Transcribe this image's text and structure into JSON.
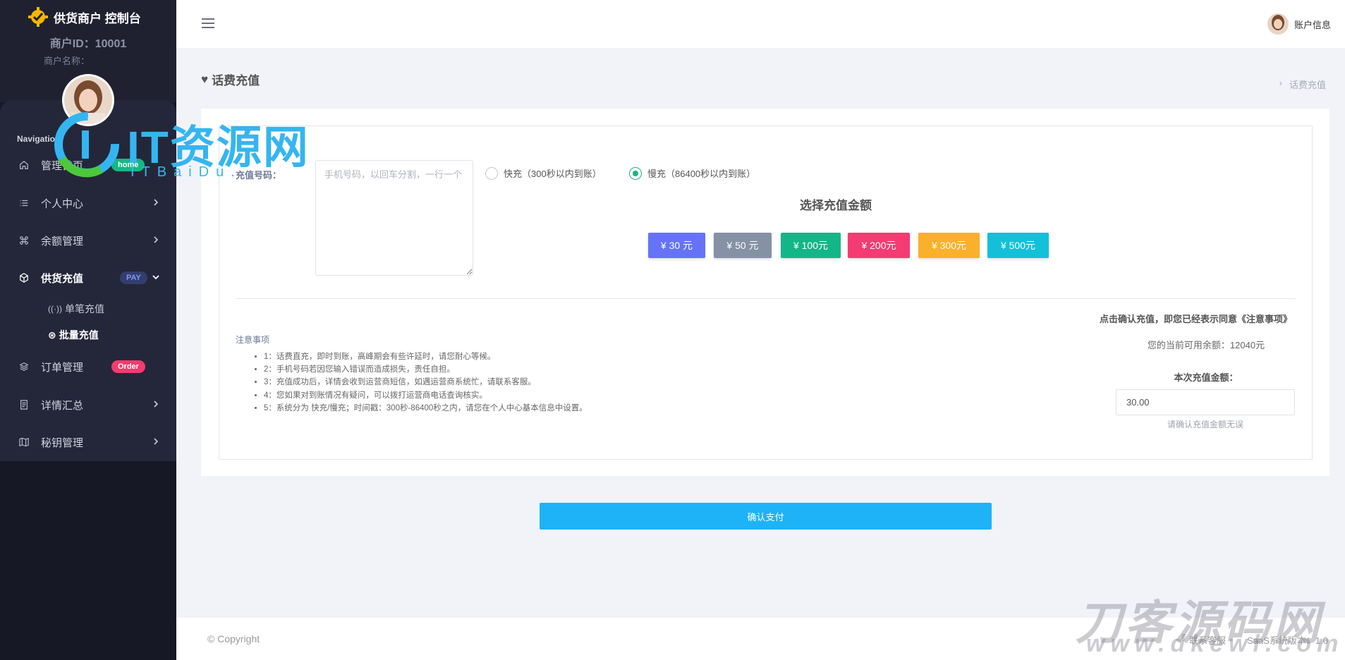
{
  "sidebar": {
    "brand": "供货商户 控制台",
    "merchant_id": "商户ID：10001",
    "merchant_name": "商户名称：",
    "nav_heading": "Navigation",
    "items": [
      {
        "label": "管理首页",
        "badge": "home"
      },
      {
        "label": "个人中心"
      },
      {
        "label": "余额管理"
      },
      {
        "label": "供货充值",
        "badge": "PAY"
      },
      {
        "label": "订单管理",
        "badge": "Order"
      },
      {
        "label": "详情汇总"
      },
      {
        "label": "秘钥管理"
      }
    ],
    "sub_items": [
      {
        "label": "单笔充值"
      },
      {
        "label": "批量充值"
      }
    ]
  },
  "topbar": {
    "account_label": "账户信息"
  },
  "page": {
    "title": "话费充值",
    "breadcrumb": "话费充值"
  },
  "form": {
    "phone_label": "充值号码：",
    "phone_placeholder": "手机号码，以回车分割，一行一个",
    "radio_fast": "快充（300秒以内到账）",
    "radio_slow": "慢充（86400秒以内到账）",
    "selected_radio": "slow",
    "amount_title": "选择充值金额",
    "amounts": [
      {
        "label": "¥ 30 元",
        "color": "#6673f7"
      },
      {
        "label": "¥ 50 元",
        "color": "#8591a5"
      },
      {
        "label": "¥ 100元",
        "color": "#13b686"
      },
      {
        "label": "¥ 200元",
        "color": "#f43b72"
      },
      {
        "label": "¥ 300元",
        "color": "#fbb02c"
      },
      {
        "label": "¥ 500元",
        "color": "#14c0d8"
      }
    ],
    "notes_title": "注意事项",
    "notes": [
      "1：话费直充，即时到账，高峰期会有些许延时，请您耐心等候。",
      "2：手机号码若因您输入错误而造成损失，责任自担。",
      "3：充值成功后，详情会收到运营商短信，如遇运营商系统忙，请联系客服。",
      "4：您如果对到账情况有疑问，可以拨打运营商电话查询核实。",
      "5：系统分为 快充/慢充；时间戳：300秒-86400秒之内，请您在个人中心基本信息中设置。"
    ],
    "agree_text": "点击确认充值，即您已经表示同意《注意事项》",
    "balance_text": "您的当前可用余额：12040元",
    "charge_label": "本次充值金额：",
    "charge_value": "30.00",
    "charge_hint": "请确认充值金额无误",
    "confirm_label": "确认支付"
  },
  "footer": {
    "copyright": "© Copyright",
    "contact": "联系客服",
    "version": "SaaS系统版本：1.0"
  },
  "watermarks": {
    "wm1_main": "IT资源网",
    "wm1_sub": "ITBaiDu.",
    "wm2_main": "刀客源码网",
    "wm2_sub": "www.dkewl.com"
  }
}
